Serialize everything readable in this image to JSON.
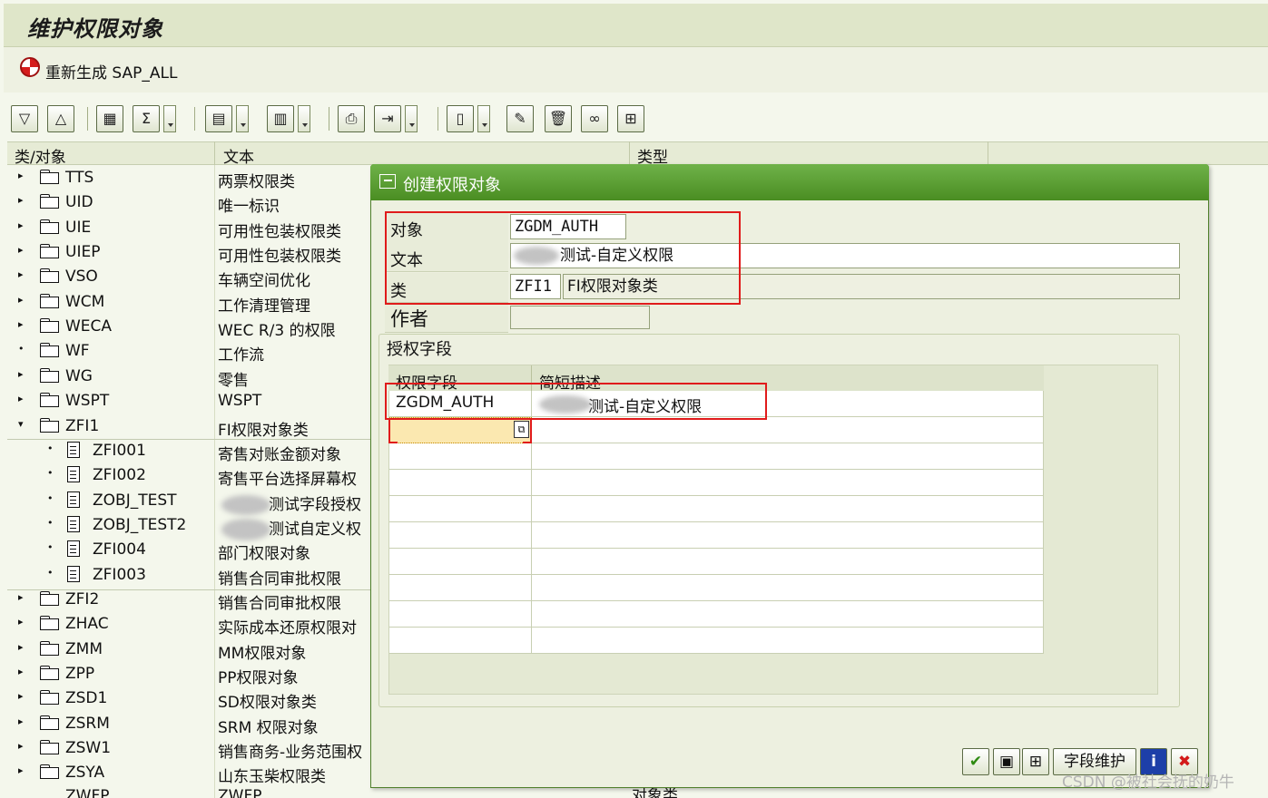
{
  "window": {
    "title": "维护权限对象"
  },
  "app_toolbar": {
    "regen_label": "重新生成 SAP_ALL",
    "regen_icon": "regen-icon"
  },
  "toolbar": {
    "icons": [
      "expand-all-icon",
      "collapse-all-icon",
      "find-icon",
      "sum-icon",
      "print-icon",
      "layout-icon",
      "print-preview-icon",
      "export-icon",
      "create-icon",
      "edit-icon",
      "delete-icon",
      "glasses-icon",
      "check-icon"
    ]
  },
  "tree": {
    "headers": [
      "类/对象",
      "文本",
      "类型"
    ],
    "rows": [
      {
        "name": "TTS",
        "text": "两票权限类",
        "kind": "folder",
        "expander": "▸"
      },
      {
        "name": "UID",
        "text": "唯一标识",
        "kind": "folder",
        "expander": "▸"
      },
      {
        "name": "UIE",
        "text": "可用性包装权限类",
        "kind": "folder",
        "expander": "▸"
      },
      {
        "name": "UIEP",
        "text": "可用性包装权限类",
        "kind": "folder",
        "expander": "▸"
      },
      {
        "name": "VSO",
        "text": "车辆空间优化",
        "kind": "folder",
        "expander": "▸"
      },
      {
        "name": "WCM",
        "text": "工作清理管理",
        "kind": "folder",
        "expander": "▸"
      },
      {
        "name": "WECA",
        "text": "WEC R/3 的权限",
        "kind": "folder",
        "expander": "▸"
      },
      {
        "name": "WF",
        "text": "工作流",
        "kind": "folder",
        "expander": "•"
      },
      {
        "name": "WG",
        "text": "零售",
        "kind": "folder",
        "expander": "▸"
      },
      {
        "name": "WSPT",
        "text": "WSPT",
        "kind": "folder",
        "expander": "▸"
      },
      {
        "name": "ZFI1",
        "text": "FI权限对象类",
        "kind": "folder-open",
        "expander": "▾"
      },
      {
        "name": "ZFI001",
        "text": "寄售对账金额对象",
        "kind": "doc",
        "expander": "•"
      },
      {
        "name": "ZFI002",
        "text": "寄售平台选择屏幕权",
        "kind": "doc",
        "expander": "•"
      },
      {
        "name": "ZOBJ_TEST",
        "text": "测试字段授权",
        "kind": "doc",
        "expander": "•"
      },
      {
        "name": "ZOBJ_TEST2",
        "text": "测试自定义权",
        "kind": "doc",
        "expander": "•"
      },
      {
        "name": "ZFI004",
        "text": "部门权限对象",
        "kind": "doc",
        "expander": "•"
      },
      {
        "name": "ZFI003",
        "text": "销售合同审批权限",
        "kind": "doc",
        "expander": "•"
      },
      {
        "name": "ZFI2",
        "text": "销售合同审批权限",
        "kind": "folder",
        "expander": "▸"
      },
      {
        "name": "ZHAC",
        "text": "实际成本还原权限对",
        "kind": "folder",
        "expander": "▸"
      },
      {
        "name": "ZMM",
        "text": "MM权限对象",
        "kind": "folder",
        "expander": "▸"
      },
      {
        "name": "ZPP",
        "text": "PP权限对象",
        "kind": "folder",
        "expander": "▸"
      },
      {
        "name": "ZSD1",
        "text": "SD权限对象类",
        "kind": "folder",
        "expander": "▸"
      },
      {
        "name": "ZSRM",
        "text": "SRM 权限对象",
        "kind": "folder",
        "expander": "▸"
      },
      {
        "name": "ZSW1",
        "text": "销售商务-业务范围权",
        "kind": "folder",
        "expander": "▸"
      },
      {
        "name": "ZSYA",
        "text": "山东玉柴权限类",
        "kind": "folder",
        "expander": "▸"
      }
    ],
    "partial_row": {
      "name": "ZWFP",
      "text": "ZWFP",
      "type": "对象类"
    }
  },
  "dialog": {
    "title": "创建权限对象",
    "fields": {
      "object_label": "对象",
      "object_value": "ZGDM_AUTH",
      "text_label": "文本",
      "text_value": "测试-自定义权限",
      "class_label": "类",
      "class_value": "ZFI1",
      "class_desc": "FI权限对象类",
      "author_label": "作者",
      "author_value": ""
    },
    "group_title": "授权字段",
    "table": {
      "headers": [
        "权限字段",
        "简短描述"
      ],
      "rows": [
        {
          "field": "ZGDM_AUTH",
          "desc": "测试-自定义权限"
        }
      ]
    },
    "buttons": {
      "field_maint": "字段维护"
    }
  },
  "watermark": "CSDN @被社会抚的奶牛",
  "colors": {
    "title_green": "#4a8d22",
    "highlight_red": "#e01b1b",
    "active_cell": "#fbe8b0"
  }
}
